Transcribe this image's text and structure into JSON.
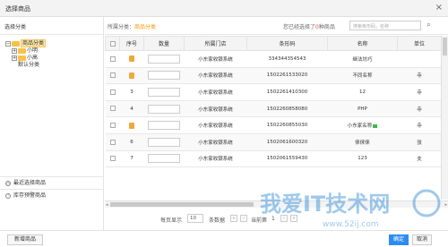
{
  "dialog": {
    "title": "选择商品",
    "close_glyph": "×"
  },
  "sidebar": {
    "header": "选择分类",
    "tree": [
      {
        "expander": "−",
        "label": "商品分类",
        "level": 0,
        "selected": true,
        "folder": true
      },
      {
        "expander": "+",
        "label": "小明",
        "level": 1,
        "selected": false,
        "folder": true
      },
      {
        "expander": "+",
        "label": "小高",
        "level": 1,
        "selected": false,
        "folder": true
      },
      {
        "expander": "",
        "label": "默认分类",
        "level": 2,
        "selected": false,
        "folder": false
      }
    ],
    "footer_items": [
      {
        "label": "最近选择商品",
        "icon": "clock-icon",
        "glyph": "◷"
      },
      {
        "label": "库存预警商品",
        "icon": "warning-icon",
        "glyph": "!"
      }
    ]
  },
  "toolbar": {
    "crumb_prefix": "所属分类：",
    "crumb_value": "商品分类",
    "count_prefix": "您已经选择了",
    "count_value": "0",
    "count_suffix": "种商品",
    "search_placeholder": "搜索条形码，名称",
    "search_glyph": "⌕"
  },
  "table": {
    "headers": [
      "",
      "序号",
      "数量",
      "所属门店",
      "条形码",
      "名称",
      "单位"
    ],
    "rows": [
      {
        "index": "",
        "store": "小东家收银系统",
        "barcode": "334344354543",
        "name": "继法坊巧",
        "unit": "",
        "has_pic": true
      },
      {
        "index": "",
        "store": "小东家收银系统",
        "barcode": "1502261533020",
        "name": "不同名称",
        "unit": "寺",
        "has_pic": true
      },
      {
        "index": "3",
        "store": "小东家收银系统",
        "barcode": "1502261410300",
        "name": "12",
        "unit": "寺",
        "has_pic": false
      },
      {
        "index": "4",
        "store": "小东家收银系统",
        "barcode": "1502260858080",
        "name": "PHP",
        "unit": "寺",
        "has_pic": false
      },
      {
        "index": "",
        "store": "小东家收银系统",
        "barcode": "1502260855030",
        "name": "小东家名称",
        "unit": "寺",
        "has_pic": true,
        "warn": true
      },
      {
        "index": "6",
        "store": "小东家收银系统",
        "barcode": "1502061600320",
        "name": "徕徕徕",
        "unit": "张",
        "has_pic": false
      },
      {
        "index": "7",
        "store": "小东家收银系统",
        "barcode": "1502061559430",
        "name": "123",
        "unit": "支",
        "has_pic": false
      }
    ]
  },
  "pager": {
    "per_page_label": "每页显示",
    "per_page_value": "10",
    "per_page_suffix": "条数据",
    "first": "«",
    "prev": "‹",
    "current_label": "当前第",
    "current_value": "1",
    "next": "›",
    "last": "»"
  },
  "footer": {
    "new_button": "新增商品",
    "confirm_button": "确定",
    "cancel_button": "取消"
  },
  "watermark": {
    "text": "我爱IT技术网",
    "url": "www.52ij.com"
  },
  "colors": {
    "accent": "#2d8cf0",
    "folder": "#f6c249",
    "category": "#f39800",
    "count": "#e74c3c"
  }
}
